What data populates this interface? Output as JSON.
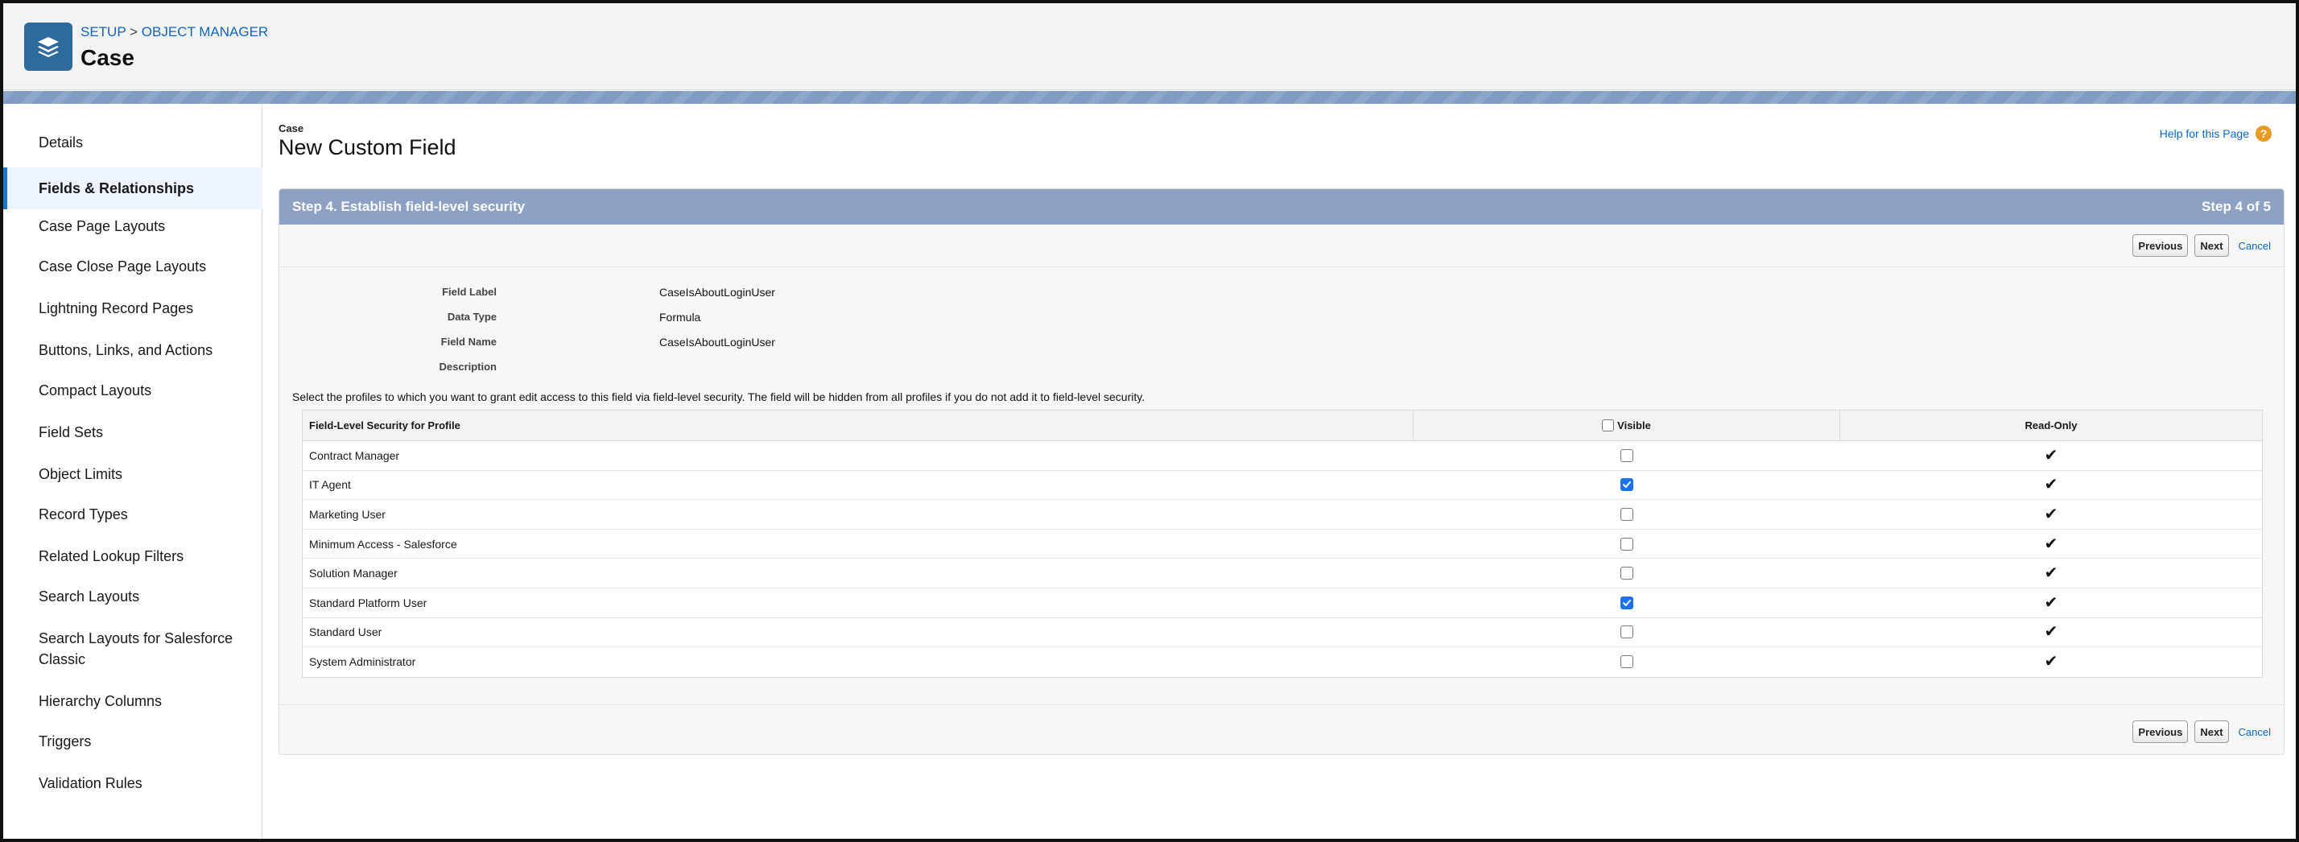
{
  "header": {
    "breadcrumb": {
      "setup": "SETUP",
      "separator": ">",
      "object_manager": "OBJECT MANAGER"
    },
    "object_title": "Case",
    "app_icon": "layers-icon"
  },
  "sidebar": {
    "items": [
      {
        "label": "Details"
      },
      {
        "label": "Fields & Relationships",
        "active": true
      },
      {
        "label": "Case Page Layouts"
      },
      {
        "label": "Case Close Page Layouts"
      },
      {
        "label": "Lightning Record Pages"
      },
      {
        "label": "Buttons, Links, and Actions"
      },
      {
        "label": "Compact Layouts"
      },
      {
        "label": "Field Sets"
      },
      {
        "label": "Object Limits"
      },
      {
        "label": "Record Types"
      },
      {
        "label": "Related Lookup Filters"
      },
      {
        "label": "Search Layouts"
      },
      {
        "label": "Search Layouts for Salesforce Classic"
      },
      {
        "label": "Hierarchy Columns"
      },
      {
        "label": "Triggers"
      },
      {
        "label": "Validation Rules"
      }
    ]
  },
  "page": {
    "object_label": "Case",
    "title": "New Custom Field",
    "help_link": "Help for this Page",
    "help_icon": "question-icon"
  },
  "wizard": {
    "step_title": "Step 4. Establish field-level security",
    "step_counter": "Step 4 of 5",
    "buttons": {
      "previous": "Previous",
      "next": "Next",
      "cancel": "Cancel"
    },
    "fields": [
      {
        "label": "Field Label",
        "value": "CaseIsAboutLoginUser"
      },
      {
        "label": "Data Type",
        "value": "Formula"
      },
      {
        "label": "Field Name",
        "value": "CaseIsAboutLoginUser"
      },
      {
        "label": "Description",
        "value": ""
      }
    ],
    "instructions": "Select the profiles to which you want to grant edit access to this field via field-level security. The field will be hidden from all profiles if you do not add it to field-level security.",
    "table": {
      "headers": {
        "profile": "Field-Level Security for Profile",
        "visible": "Visible",
        "read_only": "Read-Only"
      },
      "rows": [
        {
          "profile": "Contract Manager",
          "visible": false,
          "read_only": true
        },
        {
          "profile": "IT Agent",
          "visible": true,
          "read_only": true
        },
        {
          "profile": "Marketing User",
          "visible": false,
          "read_only": true
        },
        {
          "profile": "Minimum Access - Salesforce",
          "visible": false,
          "read_only": true
        },
        {
          "profile": "Solution Manager",
          "visible": false,
          "read_only": true
        },
        {
          "profile": "Standard Platform User",
          "visible": true,
          "read_only": true
        },
        {
          "profile": "Standard User",
          "visible": false,
          "read_only": true
        },
        {
          "profile": "System Administrator",
          "visible": false,
          "read_only": true
        }
      ]
    }
  },
  "colors": {
    "accent": "#1b76d2",
    "link": "#0b66c2",
    "step_header": "#8da1c4",
    "checkbox_checked": "#1a73e8"
  }
}
